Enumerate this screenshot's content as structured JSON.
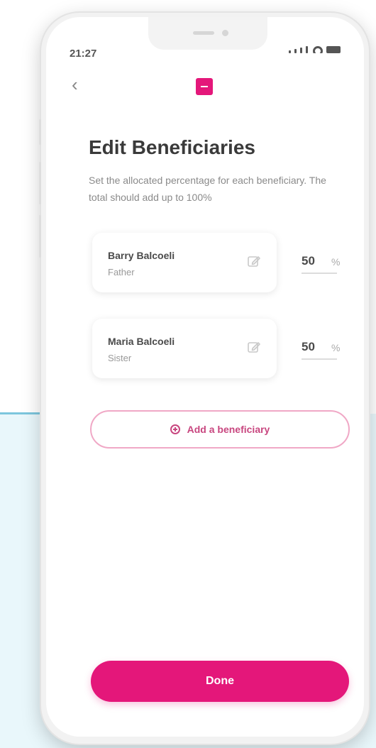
{
  "status": {
    "time": "21:27"
  },
  "header": {
    "back_icon": "chevron-left-icon",
    "logo_icon": "app-logo-icon",
    "brand_color": "#e4177a"
  },
  "title": "Edit Beneficiaries",
  "description": "Set the allocated percentage for each beneficiary. The total should add up to 100%",
  "beneficiaries": [
    {
      "name": "Barry Balcoeli",
      "relation": "Father",
      "percentage": "50",
      "unit": "%",
      "edit_icon": "edit-icon"
    },
    {
      "name": "Maria Balcoeli",
      "relation": "Sister",
      "percentage": "50",
      "unit": "%",
      "edit_icon": "edit-icon"
    }
  ],
  "add_button": {
    "label": "Add a beneficiary",
    "icon": "plus-circle-icon"
  },
  "done_button": {
    "label": "Done"
  }
}
